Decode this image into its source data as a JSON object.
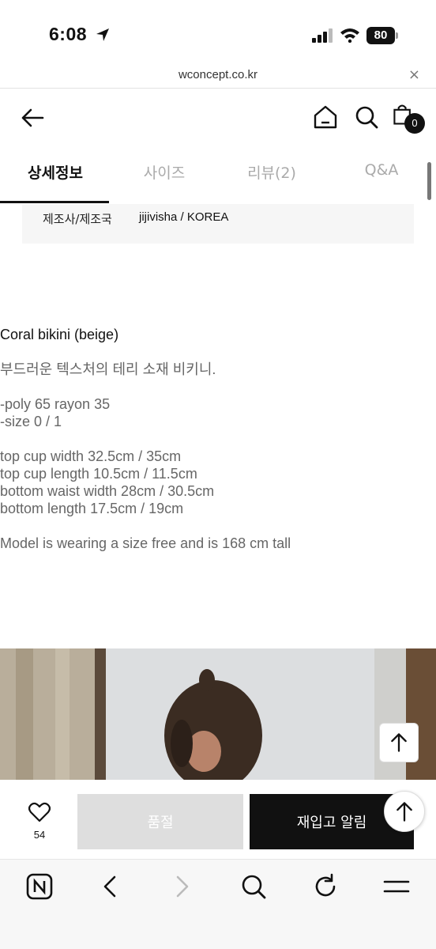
{
  "status_bar": {
    "time": "6:08",
    "battery": "80"
  },
  "url_bar": {
    "url": "wconcept.co.kr",
    "close": "×"
  },
  "header": {
    "cart_count": "0"
  },
  "tabs": [
    {
      "label": "상세정보",
      "active": true
    },
    {
      "label": "사이즈",
      "active": false
    },
    {
      "label": "리뷰(2)",
      "active": false
    },
    {
      "label": "Q&A",
      "active": false
    }
  ],
  "info_table": {
    "label": "제조사/제조국",
    "value": "jijivisha / KOREA"
  },
  "description": {
    "title": "Coral bikini (beige)",
    "summary": "부드러운 텍스처의 테리 소재 비키니.",
    "material": "-poly 65 rayon 35",
    "size": "-size 0 / 1",
    "measurements": [
      "top cup width 32.5cm / 35cm",
      "top cup length 10.5cm / 11.5cm",
      "bottom waist width 28cm / 30.5cm",
      "bottom length 17.5cm / 19cm"
    ],
    "model_note": "Model is wearing a size free and is 168 cm tall"
  },
  "action_bar": {
    "like_count": "54",
    "soldout_label": "품절",
    "restock_label": "재입고 알림"
  },
  "colors": {
    "accent": "#111111",
    "soldout_bg": "#dedede",
    "info_bg": "#f6f6f6"
  },
  "icons": [
    "location-arrow-icon",
    "signal-icon",
    "wifi-icon",
    "back-arrow-icon",
    "home-icon",
    "search-icon",
    "cart-icon",
    "arrow-up-icon",
    "heart-icon",
    "naver-icon",
    "chevron-left-icon",
    "chevron-right-icon",
    "refresh-icon",
    "menu-icon"
  ]
}
